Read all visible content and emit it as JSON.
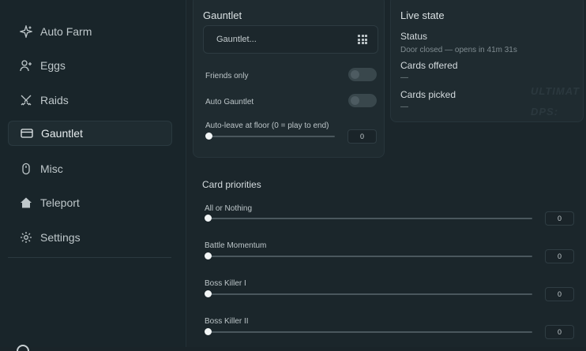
{
  "sidebar": {
    "items": [
      {
        "label": "Auto Farm",
        "icon": "sparkle-icon"
      },
      {
        "label": "Eggs",
        "icon": "user-plus-icon"
      },
      {
        "label": "Raids",
        "icon": "crossed-swords-icon"
      },
      {
        "label": "Gauntlet",
        "icon": "card-icon",
        "active": true
      },
      {
        "label": "Misc",
        "icon": "mouse-icon"
      },
      {
        "label": "Teleport",
        "icon": "home-icon"
      },
      {
        "label": "Settings",
        "icon": "gear-icon"
      }
    ]
  },
  "gauntlet": {
    "title": "Gauntlet",
    "dropdown_value": "Gauntlet...",
    "friends_only_label": "Friends only",
    "friends_only_on": false,
    "auto_gauntlet_label": "Auto Gauntlet",
    "auto_gauntlet_on": false,
    "auto_leave_label": "Auto-leave at floor (0 = play to end)",
    "auto_leave_value": "0"
  },
  "live_state": {
    "title": "Live state",
    "status_label": "Status",
    "status_value": "Door closed — opens in 41m 31s",
    "cards_offered_label": "Cards offered",
    "cards_offered_value": "—",
    "cards_picked_label": "Cards picked",
    "cards_picked_value": "—"
  },
  "overlay": {
    "line1": "ULTIMAT",
    "line2": "DPS:"
  },
  "card_priorities": {
    "title": "Card priorities",
    "items": [
      {
        "label": "All or Nothing",
        "value": "0"
      },
      {
        "label": "Battle Momentum",
        "value": "0"
      },
      {
        "label": "Boss Killer I",
        "value": "0"
      },
      {
        "label": "Boss Killer II",
        "value": "0"
      }
    ]
  },
  "colors": {
    "background": "#1a2429",
    "panel": "#1f2b30",
    "text": "#c9d0d3",
    "knob": "#f2f5f6"
  }
}
